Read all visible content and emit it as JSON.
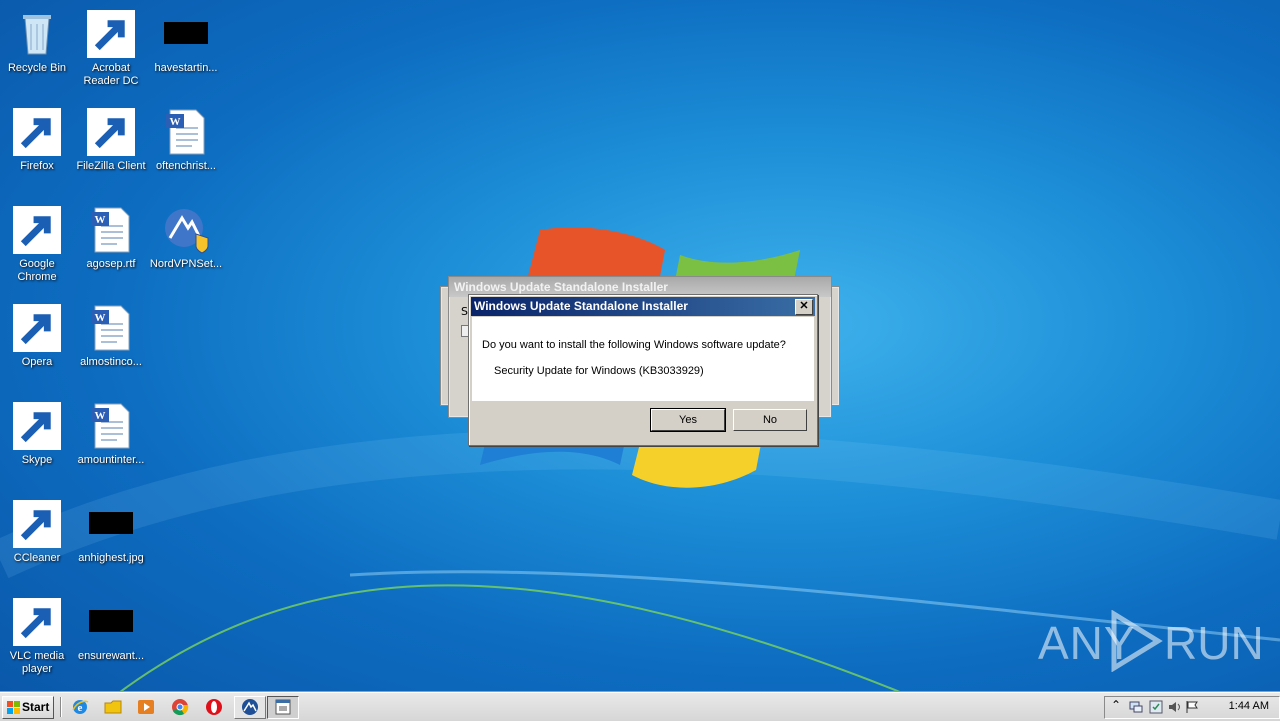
{
  "desktop": {
    "icons": [
      {
        "label": "Recycle Bin"
      },
      {
        "label": "Acrobat\nReader DC"
      },
      {
        "label": "havestartin..."
      },
      {
        "label": "Firefox"
      },
      {
        "label": "FileZilla Client"
      },
      {
        "label": "oftenchrist..."
      },
      {
        "label": "Google\nChrome"
      },
      {
        "label": "agosep.rtf"
      },
      {
        "label": "NordVPNSet..."
      },
      {
        "label": "Opera"
      },
      {
        "label": "almostinco..."
      },
      {
        "label": "Skype"
      },
      {
        "label": "amountinter..."
      },
      {
        "label": "CCleaner"
      },
      {
        "label": "anhighest.jpg"
      },
      {
        "label": "VLC media\nplayer"
      },
      {
        "label": "ensurewant..."
      }
    ]
  },
  "back_dialog": {
    "title": "Windows Update Standalone Installer",
    "partial_text": "S"
  },
  "dialog": {
    "title": "Windows Update Standalone Installer",
    "close_label": "✕",
    "question": "Do you want to install the following Windows software update?",
    "update_name": "Security Update for Windows (KB3033929)",
    "yes_label": "Yes",
    "no_label": "No"
  },
  "taskbar": {
    "start_label": "Start",
    "clock": "1:44 AM",
    "tray_expand": "⌃"
  },
  "watermark": {
    "left": "ANY",
    "right": "RUN"
  },
  "colors": {
    "desktop_blue": "#1d8fd8",
    "title_active": "#0a246a",
    "dialog_face": "#d4d0c8"
  }
}
